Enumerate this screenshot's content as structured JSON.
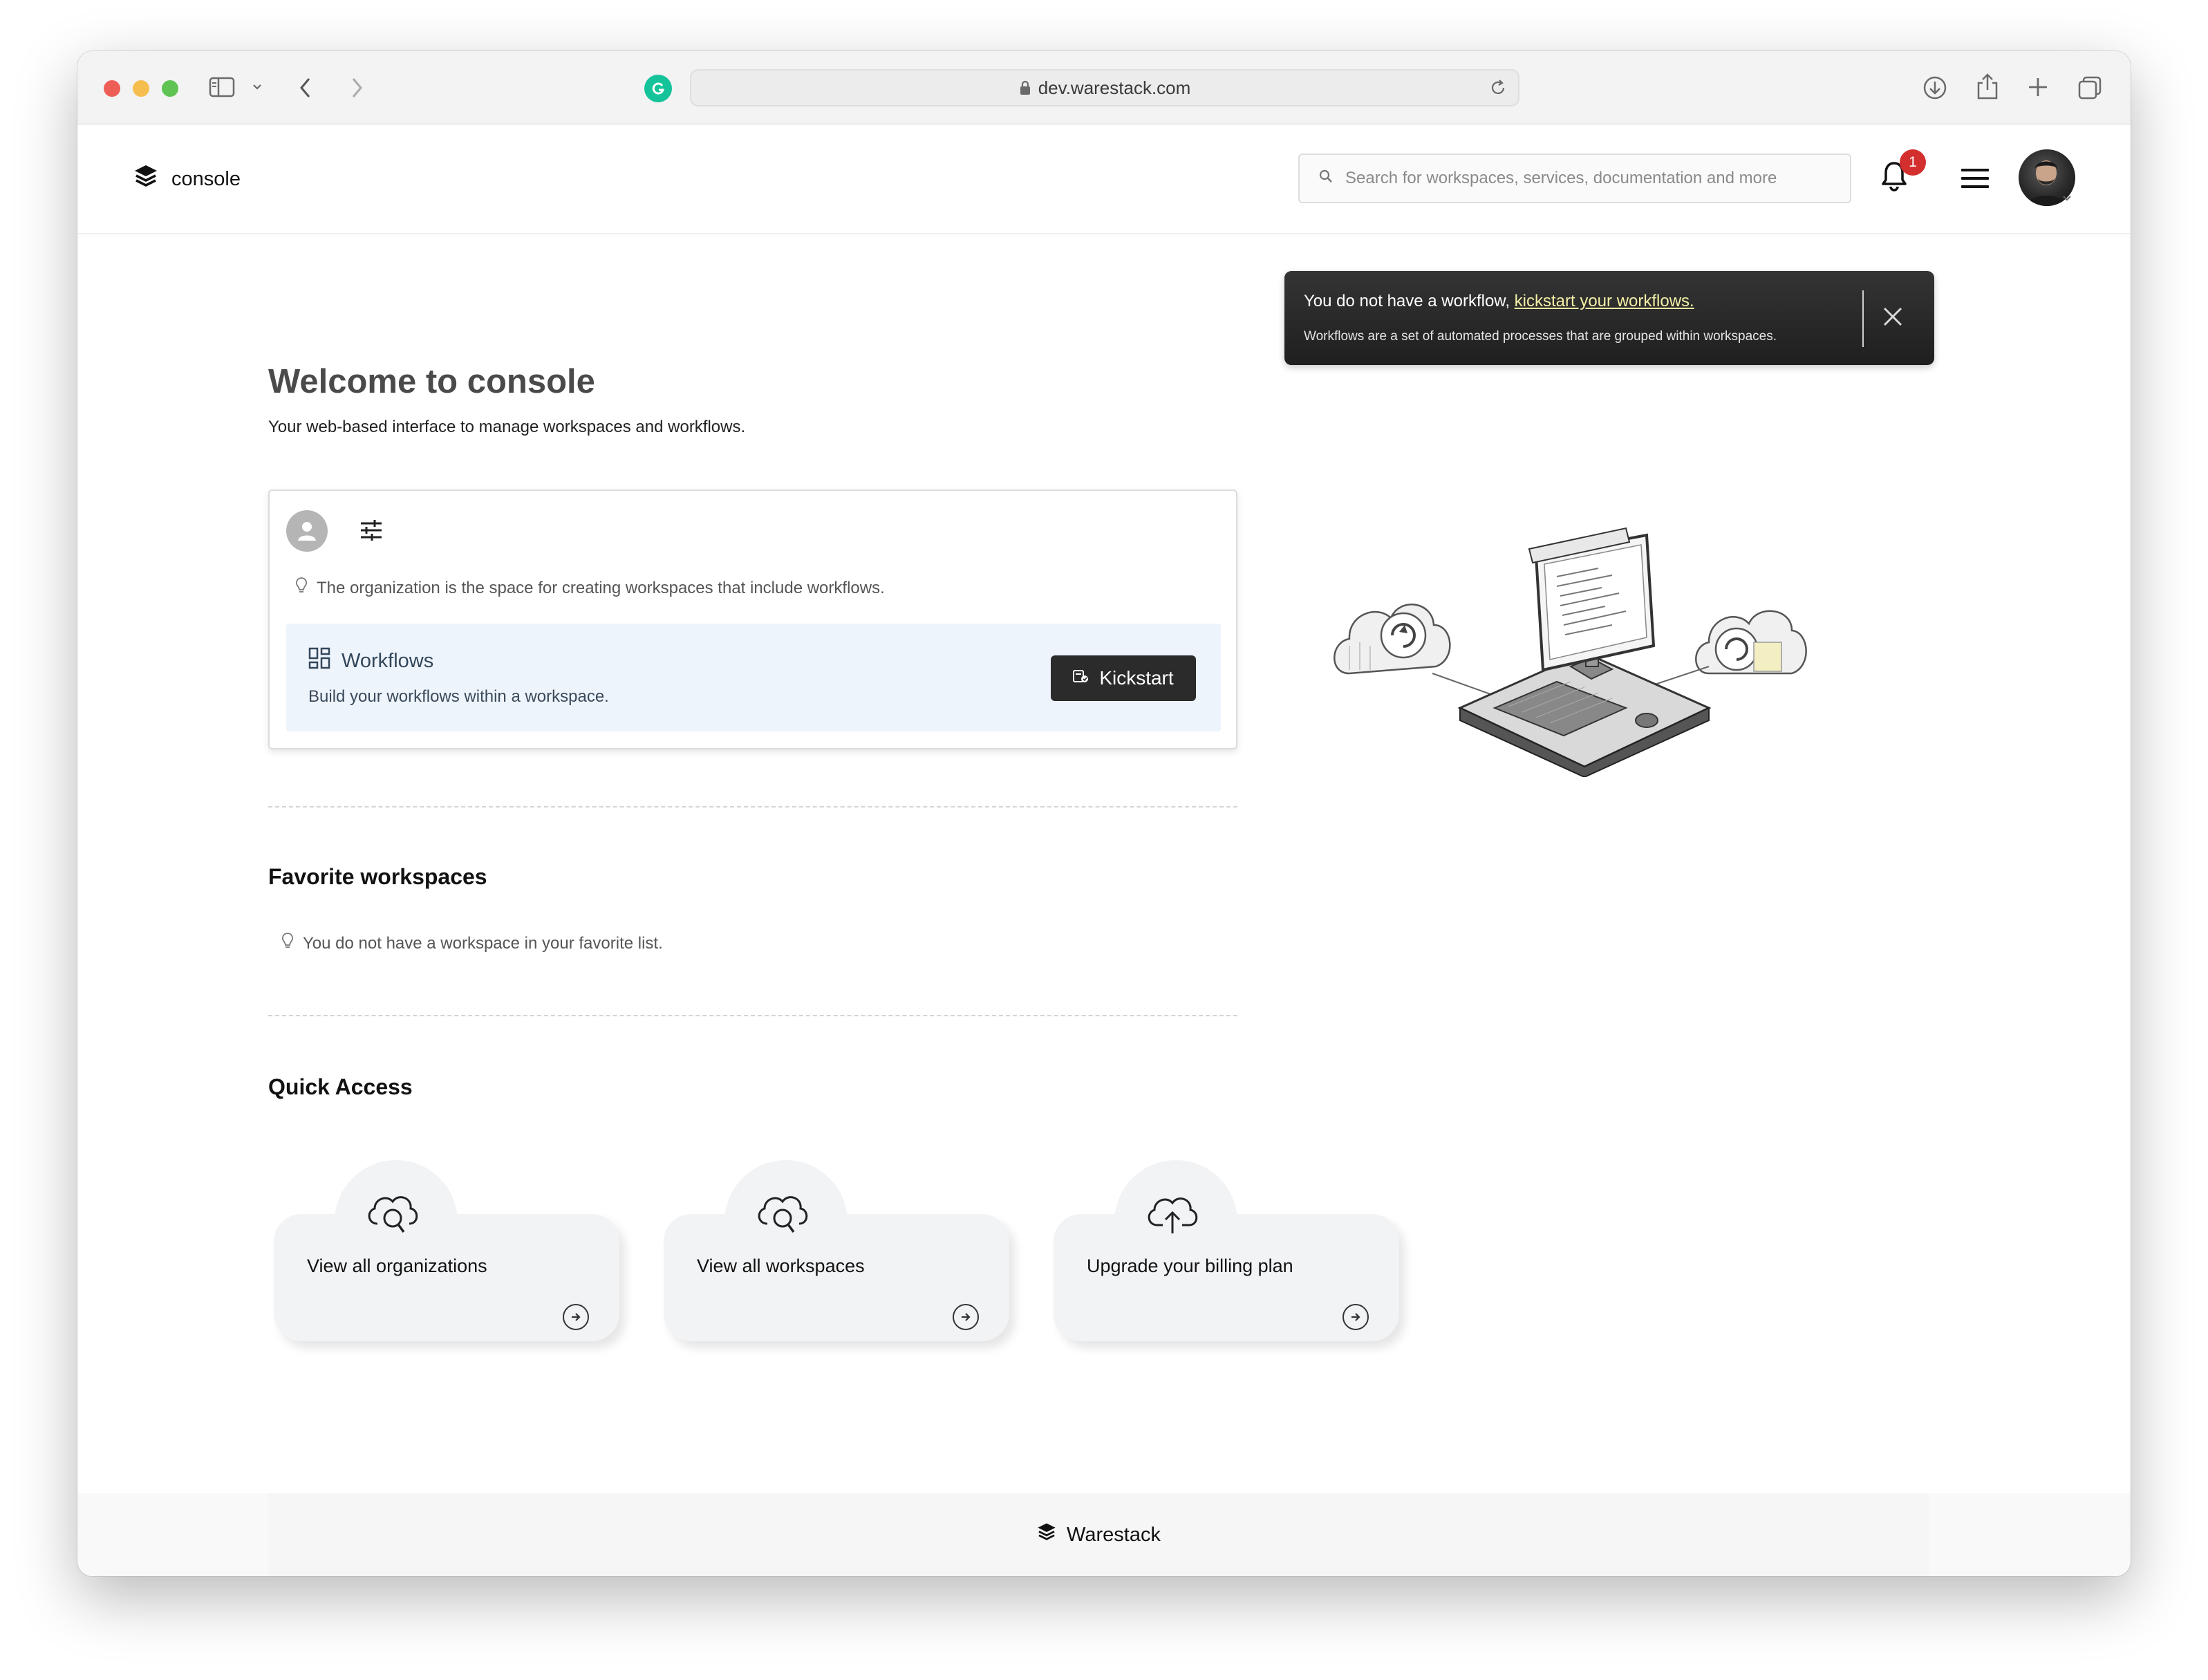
{
  "browser": {
    "url": "dev.warestack.com"
  },
  "header": {
    "brand": "console",
    "search_placeholder": "Search for workspaces, services, documentation and more",
    "notification_count": "1"
  },
  "toast": {
    "text": "You do not have a workflow, ",
    "link": "kickstart your workflows.",
    "description": "Workflows are a set of automated processes that are grouped within workspaces."
  },
  "main": {
    "title": "Welcome to console",
    "subtitle": "Your web-based interface to manage workspaces and workflows.",
    "org_card": {
      "hint": "The organization is the space for creating workspaces that include workflows.",
      "workflows_title": "Workflows",
      "workflows_desc": "Build your workflows within a workspace.",
      "kickstart_label": "Kickstart"
    },
    "favorites": {
      "title": "Favorite workspaces",
      "empty": "You do not have a workspace in your favorite list."
    },
    "quick_access": {
      "title": "Quick Access",
      "items": [
        {
          "label": "View all organizations",
          "icon": "cloud-search-icon"
        },
        {
          "label": "View all workspaces",
          "icon": "cloud-search-icon"
        },
        {
          "label": "Upgrade your billing plan",
          "icon": "cloud-upload-icon"
        }
      ]
    }
  },
  "footer": {
    "brand": "Warestack"
  },
  "colors": {
    "toast_bg": "#2a2a2a",
    "toast_link": "#f3efa6",
    "badge": "#d32f2f",
    "workflow_box": "#eef4fb",
    "kickstart_button": "#2b2b2b"
  }
}
